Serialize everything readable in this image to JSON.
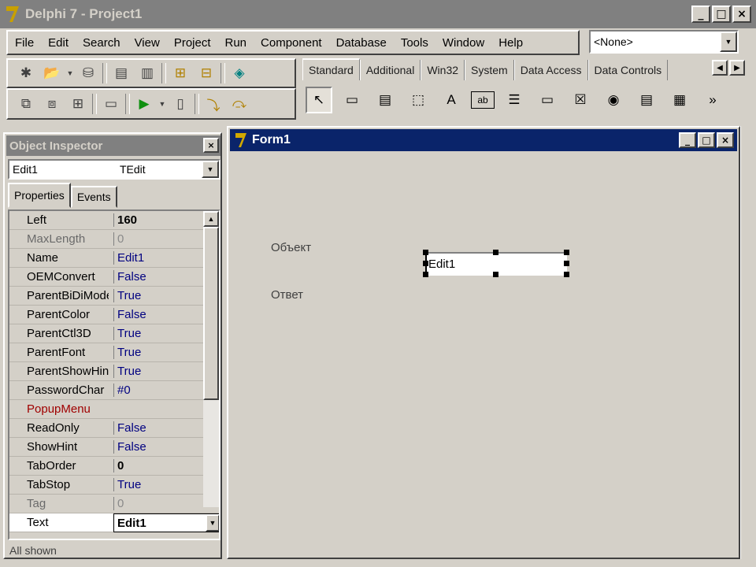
{
  "window": {
    "title": "Delphi 7 - Project1",
    "min": "_",
    "max": "□",
    "close": "×"
  },
  "menu": [
    "File",
    "Edit",
    "Search",
    "View",
    "Project",
    "Run",
    "Component",
    "Database",
    "Tools",
    "Window",
    "Help"
  ],
  "desktop_combo": "<None>",
  "palette": {
    "tabs": [
      "Standard",
      "Additional",
      "Win32",
      "System",
      "Data Access",
      "Data Controls"
    ],
    "active_tab": "Standard",
    "components": [
      {
        "icon": "pointer-icon",
        "glyph": "↖"
      },
      {
        "icon": "frame-icon",
        "glyph": "▭"
      },
      {
        "icon": "main-menu-icon",
        "glyph": "▤"
      },
      {
        "icon": "popup-menu-icon",
        "glyph": "⬚"
      },
      {
        "icon": "label-icon",
        "glyph": "A"
      },
      {
        "icon": "edit-icon",
        "glyph": "ab"
      },
      {
        "icon": "memo-icon",
        "glyph": "☰"
      },
      {
        "icon": "button-icon",
        "glyph": "▭"
      },
      {
        "icon": "checkbox-icon",
        "glyph": "☒"
      },
      {
        "icon": "radiobutton-icon",
        "glyph": "◉"
      },
      {
        "icon": "listbox-icon",
        "glyph": "▤"
      },
      {
        "icon": "combobox-icon",
        "glyph": "▦"
      },
      {
        "icon": "more-icon",
        "glyph": "»"
      }
    ]
  },
  "inspector": {
    "title": "Object Inspector",
    "selected_name": "Edit1",
    "selected_type": "TEdit",
    "tabs": [
      "Properties",
      "Events"
    ],
    "properties": [
      {
        "name": "Left",
        "value": "160",
        "style": "bold"
      },
      {
        "name": "MaxLength",
        "value": "0",
        "style": "dim"
      },
      {
        "name": "Name",
        "value": "Edit1",
        "style": ""
      },
      {
        "name": "OEMConvert",
        "value": "False",
        "style": ""
      },
      {
        "name": "ParentBiDiMode",
        "value": "True",
        "style": ""
      },
      {
        "name": "ParentColor",
        "value": "False",
        "style": ""
      },
      {
        "name": "ParentCtl3D",
        "value": "True",
        "style": ""
      },
      {
        "name": "ParentFont",
        "value": "True",
        "style": ""
      },
      {
        "name": "ParentShowHint",
        "value": "True",
        "style": ""
      },
      {
        "name": "PasswordChar",
        "value": "#0",
        "style": ""
      },
      {
        "name": "PopupMenu",
        "value": "",
        "style": "event"
      },
      {
        "name": "ReadOnly",
        "value": "False",
        "style": ""
      },
      {
        "name": "ShowHint",
        "value": "False",
        "style": ""
      },
      {
        "name": "TabOrder",
        "value": "0",
        "style": "bold"
      },
      {
        "name": "TabStop",
        "value": "True",
        "style": ""
      },
      {
        "name": "Tag",
        "value": "0",
        "style": "dim"
      },
      {
        "name": "Text",
        "value": "Edit1",
        "style": "selected"
      }
    ],
    "status": "All shown"
  },
  "form": {
    "title": "Form1",
    "label1": "Объект",
    "label2": "Ответ",
    "edit_text": "Edit1"
  },
  "colors": {
    "active_caption": "#0a246a",
    "inactive_caption": "#808080",
    "face": "#d4d0c8"
  }
}
